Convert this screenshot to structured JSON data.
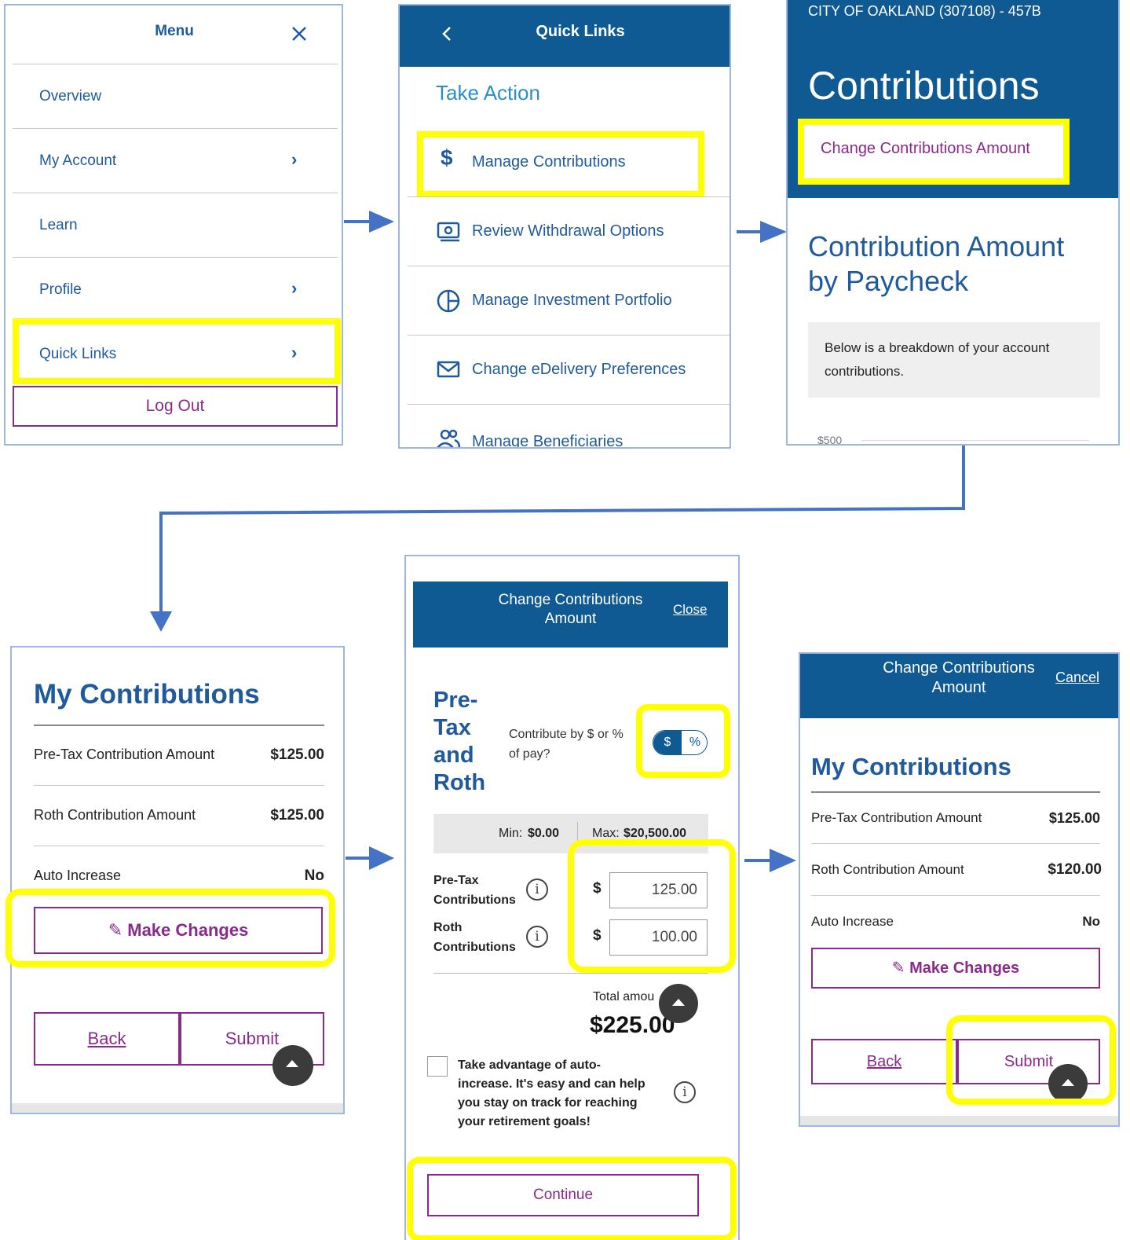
{
  "colors": {
    "brand_blue": "#0f5a92",
    "link_blue": "#1f5a9c",
    "accent_purple": "#8a2a8c",
    "highlight": "#ffff00",
    "arrow": "#4472c4"
  },
  "menu": {
    "title": "Menu",
    "close_icon": "close-icon",
    "items": [
      {
        "label": "Overview",
        "chevron": false
      },
      {
        "label": "My Account",
        "chevron": true
      },
      {
        "label": "Learn",
        "chevron": false
      },
      {
        "label": "Profile",
        "chevron": true
      },
      {
        "label": "Quick Links",
        "chevron": true
      }
    ],
    "logout_label": "Log Out"
  },
  "quick_links": {
    "title": "Quick Links",
    "section_title": "Take Action",
    "items": [
      {
        "label": "Manage Contributions",
        "icon": "dollar-icon"
      },
      {
        "label": "Review Withdrawal Options",
        "icon": "cash-icon"
      },
      {
        "label": "Manage Investment Portfolio",
        "icon": "pie-chart-icon"
      },
      {
        "label": "Change eDelivery Preferences",
        "icon": "envelope-icon"
      },
      {
        "label": "Manage Beneficiaries",
        "icon": "people-icon"
      }
    ]
  },
  "contributions_page": {
    "account": "CITY OF OAKLAND (307108) - 457B",
    "title": "Contributions",
    "change_link": "Change Contributions Amount",
    "section_title_line1": "Contribution Amount",
    "section_title_line2": "by Paycheck",
    "info_text": "Below is a breakdown of your account contributions.",
    "axis_label": "$500"
  },
  "my_contributions_1": {
    "title": "My Contributions",
    "rows": [
      {
        "label": "Pre-Tax Contribution Amount",
        "value": "$125.00"
      },
      {
        "label": "Roth Contribution Amount",
        "value": "$125.00"
      },
      {
        "label": "Auto Increase",
        "value": "No"
      }
    ],
    "make_changes_label": "Make Changes",
    "back_label": "Back",
    "submit_label": "Submit"
  },
  "change_form": {
    "header_title_line1": "Change Contributions",
    "header_title_line2": "Amount",
    "close_label": "Close",
    "heading_lines": [
      "Pre-",
      "Tax",
      "and",
      "Roth"
    ],
    "contribute_by_line1": "Contribute by $ or %",
    "contribute_by_line2": "of pay?",
    "toggle_dollar": "$",
    "toggle_percent": "%",
    "min_label": "Min:",
    "min_value": "$0.00",
    "max_label": "Max:",
    "max_value": "$20,500.00",
    "pretax_label_line1": "Pre-Tax",
    "pretax_label_line2": "Contributions",
    "roth_label_line1": "Roth",
    "roth_label_line2": "Contributions",
    "currency_symbol": "$",
    "pretax_value": "125.00",
    "roth_value": "100.00",
    "total_label": "Total amou",
    "total_value": "$225.00",
    "auto_increase_lines": [
      "Take advantage of auto-",
      "increase. It's easy and can help",
      "you stay on track for reaching",
      "your retirement goals!"
    ],
    "continue_label": "Continue"
  },
  "my_contributions_2": {
    "header_title_line1": "Change Contributions",
    "header_title_line2": "Amount",
    "cancel_label": "Cancel",
    "title": "My Contributions",
    "rows": [
      {
        "label": "Pre-Tax Contribution Amount",
        "value": "$125.00"
      },
      {
        "label": "Roth Contribution Amount",
        "value": "$120.00"
      },
      {
        "label": "Auto Increase",
        "value": "No"
      }
    ],
    "make_changes_label": "Make Changes",
    "back_label": "Back",
    "submit_label": "Submit"
  }
}
